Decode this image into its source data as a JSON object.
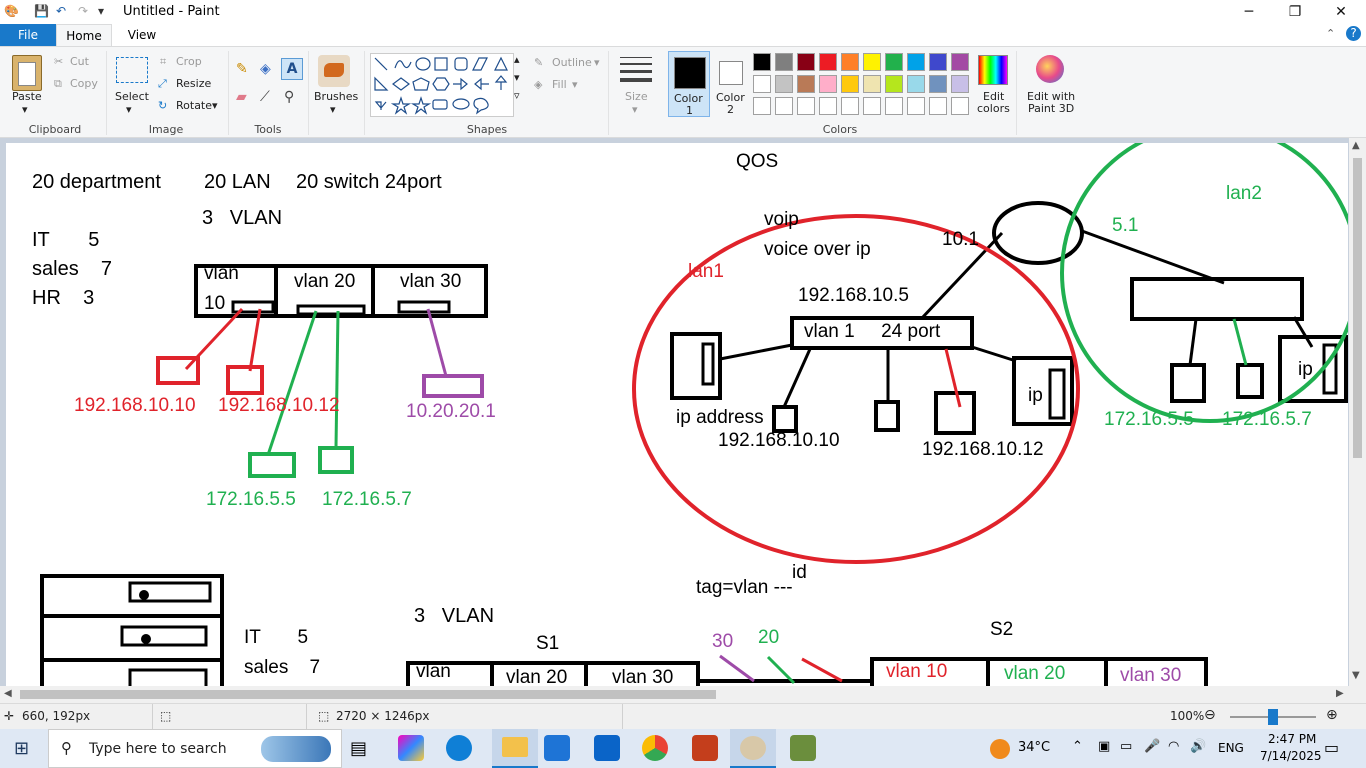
{
  "window": {
    "title": "Untitled - Paint",
    "controls": {
      "minimize": "─",
      "maximize": "❐",
      "close": "✕"
    }
  },
  "tabs": {
    "file": "File",
    "home": "Home",
    "view": "View"
  },
  "ribbon": {
    "clipboard": {
      "paste": "Paste",
      "cut": "Cut",
      "copy": "Copy",
      "group": "Clipboard"
    },
    "image": {
      "select": "Select",
      "crop": "Crop",
      "resize": "Resize",
      "rotate": "Rotate",
      "group": "Image"
    },
    "tools": {
      "group": "Tools"
    },
    "brushes": {
      "label": "Brushes"
    },
    "shapes": {
      "outline": "Outline",
      "fill": "Fill",
      "group": "Shapes"
    },
    "size": {
      "label": "Size"
    },
    "colors": {
      "color1_line1": "Color",
      "color1_line2": "1",
      "color2_line1": "Color",
      "color2_line2": "2",
      "edit_line1": "Edit",
      "edit_line2": "colors",
      "paint3d_line1": "Edit with",
      "paint3d_line2": "Paint 3D",
      "group": "Colors",
      "palette_row1": [
        "#000000",
        "#7f7f7f",
        "#880015",
        "#ed1c24",
        "#ff7f27",
        "#fff200",
        "#22b14c",
        "#00a2e8",
        "#3f48cc",
        "#a349a4"
      ],
      "palette_row2": [
        "#ffffff",
        "#c3c3c3",
        "#b97a57",
        "#ffaec9",
        "#ffc90e",
        "#efe4b0",
        "#b5e61d",
        "#99d9ea",
        "#7092be",
        "#c8bfe7"
      ]
    }
  },
  "canvas_text": {
    "line1": "20 department",
    "line1b": "20 LAN",
    "line1c": "20 switch 24port",
    "vlan3": "3   VLAN",
    "it": "IT       5",
    "sales": "sales    7",
    "hr": "HR    3",
    "vlan10a": "vlan",
    "vlan10b": "10",
    "vlan20": "vlan 20",
    "vlan30": "vlan 30",
    "ip_r1": "192.168.10.10",
    "ip_r2": "192.168.10.12",
    "ip_p1": "10.20.20.1",
    "ip_g1": "172.16.5.5",
    "ip_g2": "172.16.5.7",
    "qos": "QOS",
    "voip": "voip",
    "voice": "voice over ip",
    "lan1": "lan1",
    "ten_one": "10.1",
    "lan2": "lan2",
    "five_one": "5.1",
    "ip_hdr": "192.168.10.5",
    "vlan1": "vlan 1     24 port",
    "ip_address": "ip address",
    "ip_mid1": "192.168.10.10",
    "ip_mid2": "192.168.10.12",
    "ip_box": "ip",
    "ip_box2": "ip",
    "ip_lan2_1": "172.16.5.5",
    "ip_lan2_2": "172.16.5.7",
    "tag": "tag=vlan ---",
    "id": "id",
    "vlan3b": "3   VLAN",
    "it2": "IT       5",
    "sales2": "sales    7",
    "s1": "S1",
    "s2": "S2",
    "n30": "30",
    "n20": "20",
    "b_vlan": "vlan",
    "b_vlan20": "vlan 20",
    "b_vlan30": "vlan 30",
    "s2_vlan10": "vlan 10",
    "s2_vlan20": "vlan 20",
    "s2_vlan30": "vlan 30"
  },
  "statusbar": {
    "cursor": "660, 192px",
    "size": "2720 × 1246px",
    "zoom": "100%"
  },
  "taskbar": {
    "search_placeholder": "Type here to search",
    "weather": "34°C",
    "lang": "ENG",
    "time": "2:47 PM",
    "date": "7/14/2025"
  },
  "colors": {
    "red": "#e0232b",
    "green": "#20b050",
    "purple": "#9e4ba8",
    "accent": "#1979ca"
  }
}
